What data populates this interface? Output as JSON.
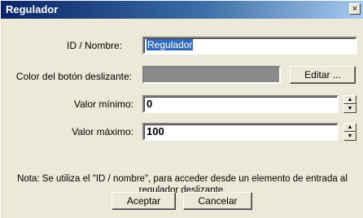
{
  "window": {
    "title": "Regulador",
    "close_glyph": "×"
  },
  "form": {
    "id_label": "ID / Nombre:",
    "id_value": "Regulador",
    "color_label": "Color del botón deslizante:",
    "slider_color": "#8a8a8a",
    "edit_button": "Editar ...",
    "min_label": "Valor mínimo:",
    "min_value": "0",
    "max_label": "Valor máximo:",
    "max_value": "100",
    "spin_up_glyph": "▲",
    "spin_down_glyph": "▼"
  },
  "note": "Nota: Se utiliza el \"ID / nombre\", para acceder desde un elemento de entrada al regulador deslizante.",
  "buttons": {
    "ok": "Aceptar",
    "cancel": "Cancelar"
  }
}
